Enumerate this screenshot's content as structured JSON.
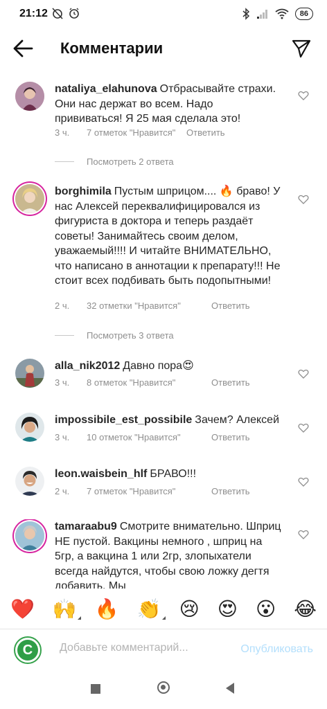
{
  "status_bar": {
    "time": "21:12",
    "battery": "86"
  },
  "header": {
    "title": "Комментарии"
  },
  "comments": [
    {
      "username": "nataliya_elahunova",
      "text": "Отбрасывайте страхи. Они нас держат во всем. Надо прививаться! Я 25 мая сделала это!",
      "time": "3 ч.",
      "likes": "7 отметок \"Нравится\"",
      "reply": "Ответить",
      "view_replies": "Посмотреть 2 ответа"
    },
    {
      "username": "borghimila",
      "text": "Пустым шприцом.... 🔥 браво! У нас Алексей переквалифицировался из фигуриста в доктора и теперь раздаёт советы! Занимайтесь своим делом, уважаемый!!!! И читайте ВНИМАТЕЛЬНО, что написано в аннотации к препарату!!! Не стоит всех подбивать быть подопытными!",
      "time": "2 ч.",
      "likes": "32 отметки \"Нравится\"",
      "reply": "Ответить",
      "view_replies": "Посмотреть 3 ответа"
    },
    {
      "username": "alla_nik2012",
      "text": "Давно пора😍",
      "time": "3 ч.",
      "likes": "8 отметок \"Нравится\"",
      "reply": "Ответить"
    },
    {
      "username": "impossibile_est_possibile",
      "text": "Зачем? Алексей",
      "time": "3 ч.",
      "likes": "10 отметок \"Нравится\"",
      "reply": "Ответить"
    },
    {
      "username": "leon.waisbein_hlf",
      "text": "БРАВО!!!",
      "time": "2 ч.",
      "likes": "7 отметок \"Нравится\"",
      "reply": "Ответить"
    },
    {
      "username": "tamaraabu9",
      "text": "Смотрите внимательно. Шприц НЕ пустой. Вакцины немного , шприц на 5гр, а вакцина 1 или 2гр, злопыхатели всегда найдутся, чтобы свою ложку дегтя  добавить. Мы",
      "time": "",
      "likes": "",
      "reply": ""
    }
  ],
  "emoji_bar": [
    "❤️",
    "🙌",
    "🔥",
    "👏",
    "😢",
    "😍",
    "😮",
    "😂"
  ],
  "input": {
    "avatar_letter": "C",
    "placeholder": "Добавьте комментарий...",
    "publish": "Опубликовать"
  },
  "colors": {
    "text": "#262626",
    "meta": "#8e8e8e",
    "publish_disabled": "#b3dffc",
    "story_ring": "#d6249f",
    "avatar_green": "#2f9e47"
  }
}
